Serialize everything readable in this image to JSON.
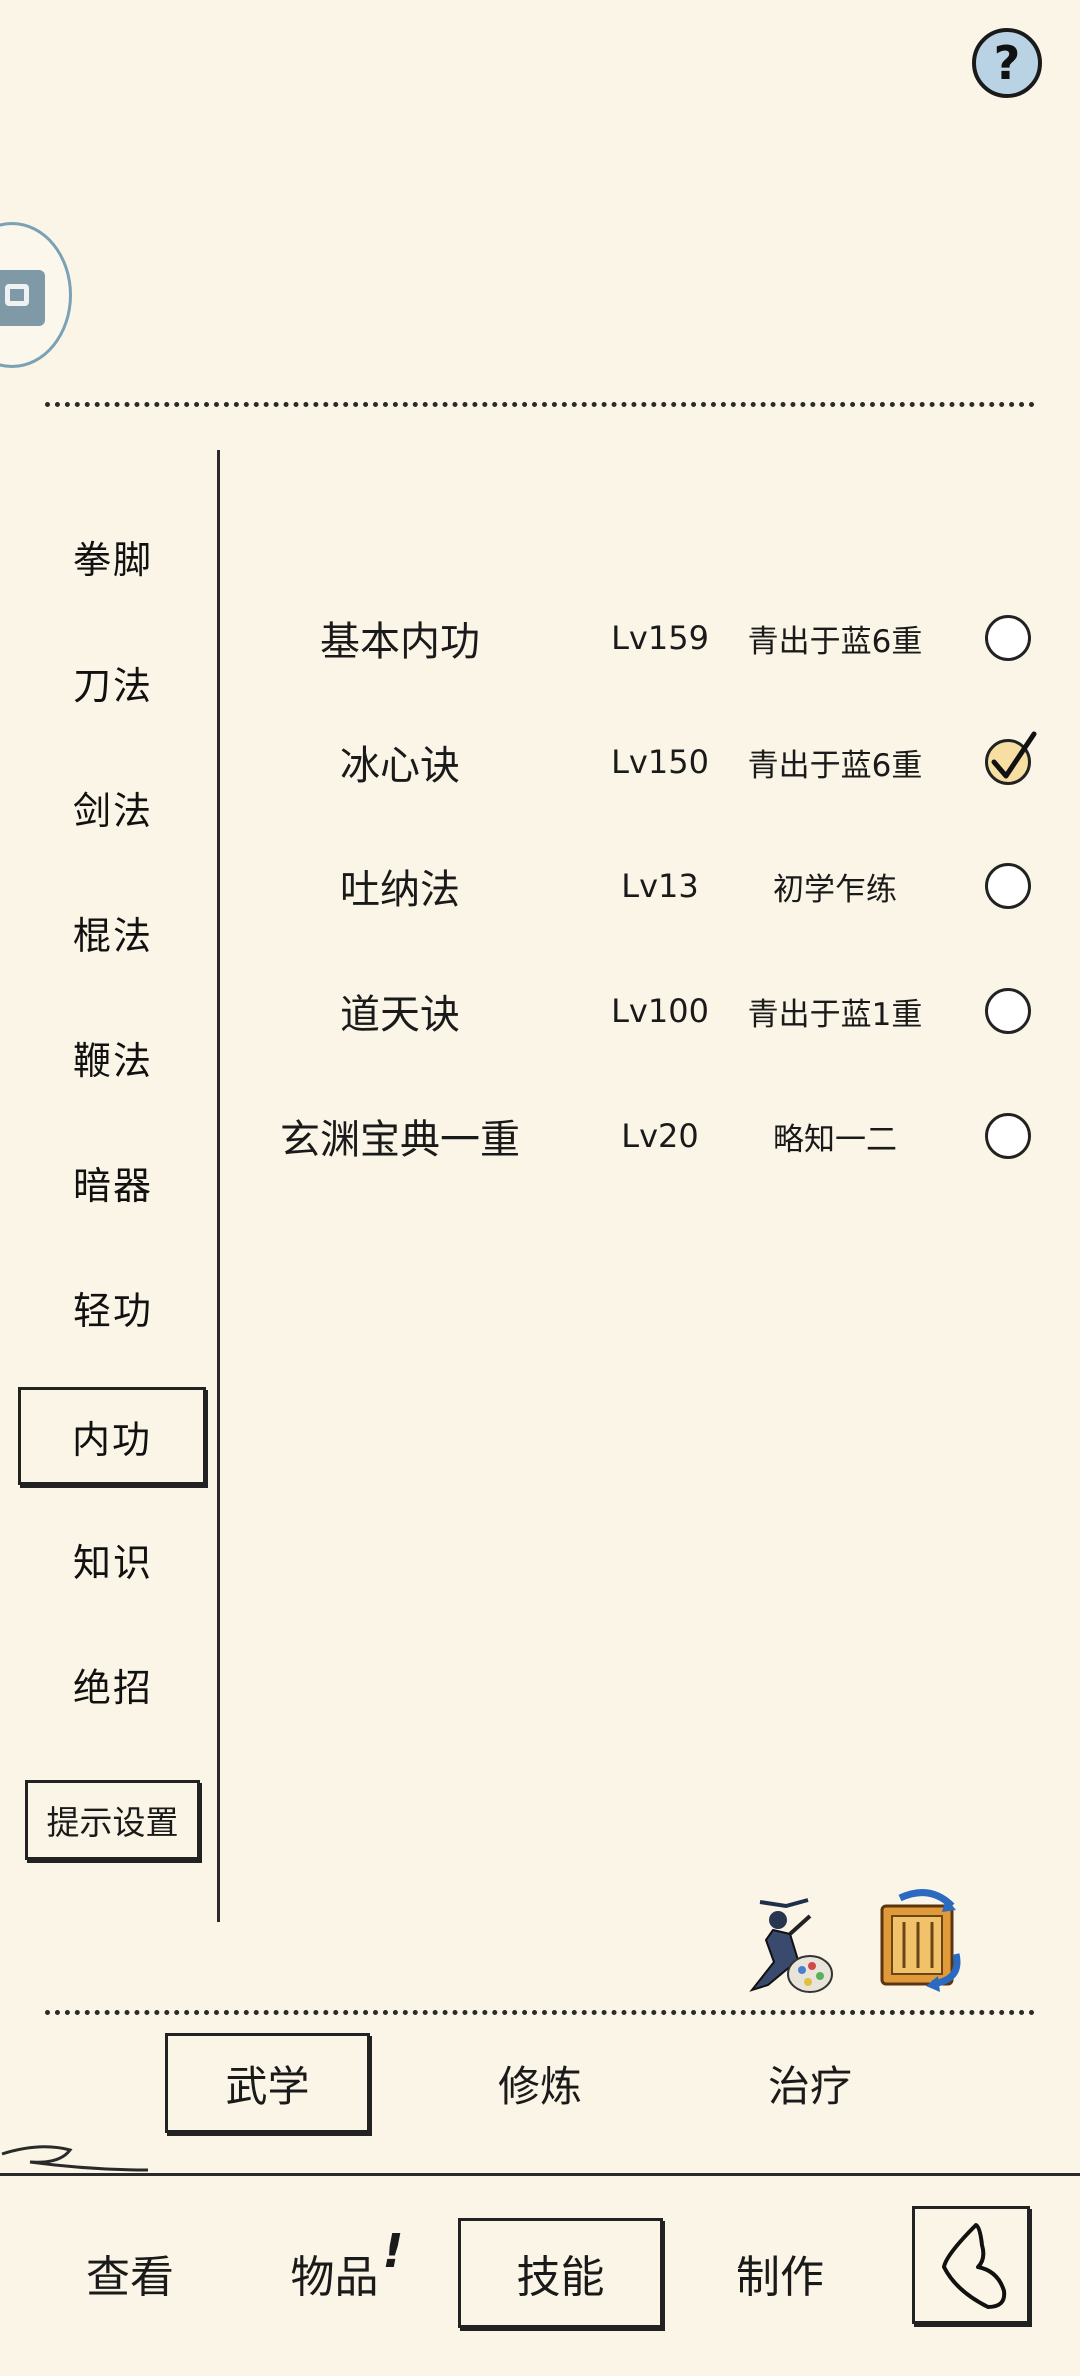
{
  "header": {
    "help_label": "?"
  },
  "categories": [
    {
      "label": "拳脚"
    },
    {
      "label": "刀法"
    },
    {
      "label": "剑法"
    },
    {
      "label": "棍法"
    },
    {
      "label": "鞭法"
    },
    {
      "label": "暗器"
    },
    {
      "label": "轻功"
    },
    {
      "label": "内功",
      "active": true
    },
    {
      "label": "知识"
    },
    {
      "label": "绝招"
    }
  ],
  "hint_settings_label": "提示设置",
  "skills": [
    {
      "name": "基本内功",
      "level": "Lv159",
      "rank": "青出于蓝6重",
      "checked": false
    },
    {
      "name": "冰心诀",
      "level": "Lv150",
      "rank": "青出于蓝6重",
      "checked": true
    },
    {
      "name": "吐纳法",
      "level": "Lv13",
      "rank": "初学乍练",
      "checked": false
    },
    {
      "name": "道天诀",
      "level": "Lv100",
      "rank": "青出于蓝1重",
      "checked": false
    },
    {
      "name": "玄渊宝典一重",
      "level": "Lv20",
      "rank": "略知一二",
      "checked": false
    }
  ],
  "tools": [
    {
      "icon": "martial-artist-palette-icon"
    },
    {
      "icon": "scroll-swap-icon"
    }
  ],
  "subtabs": [
    {
      "label": "武学",
      "active": true
    },
    {
      "label": "修炼"
    },
    {
      "label": "治疗"
    }
  ],
  "nav": [
    {
      "label": "查看"
    },
    {
      "label": "物品",
      "badge": "!"
    },
    {
      "label": "技能",
      "active": true
    },
    {
      "label": "制作"
    }
  ]
}
